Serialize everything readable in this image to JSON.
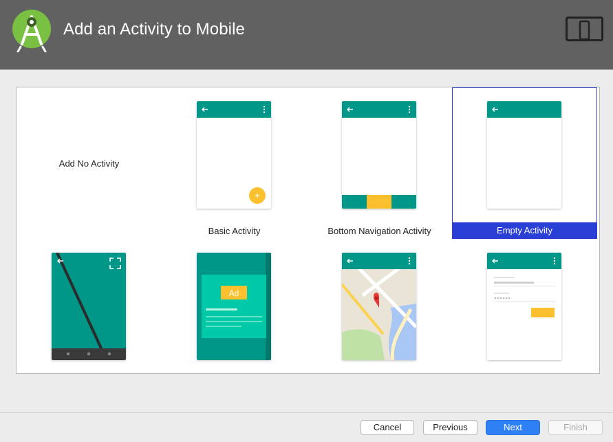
{
  "header": {
    "title": "Add an Activity to Mobile",
    "logo_icon": "android-studio-logo-icon",
    "device_icon": "tablet-phone-icon",
    "background": "#616161"
  },
  "gallery": {
    "items": [
      {
        "label": "Add No Activity"
      },
      {
        "label": "Basic Activity"
      },
      {
        "label": "Bottom Navigation Activity"
      },
      {
        "label": "Empty Activity",
        "selected": true
      },
      {
        "label": ""
      },
      {
        "label": ""
      },
      {
        "label": ""
      },
      {
        "label": ""
      }
    ],
    "ad_badge": "Ad",
    "accent_color": "#009688",
    "highlight_color": "#2a3fd6"
  },
  "footer": {
    "cancel_label": "Cancel",
    "previous_label": "Previous",
    "next_label": "Next",
    "finish_label": "Finish"
  }
}
